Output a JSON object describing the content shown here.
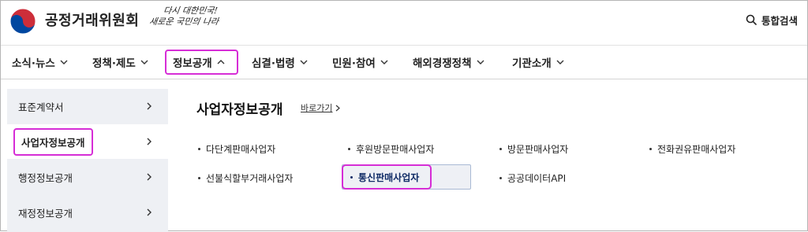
{
  "header": {
    "org_name": "공정거래위원회",
    "slogan_line1": "다시 대한민국!",
    "slogan_line2": "새로운 국민의 나라",
    "search_label": "통합검색",
    "logo_icon": "taegeuk-logo-icon"
  },
  "nav": {
    "items": [
      {
        "label": "소식·뉴스"
      },
      {
        "label": "정책·제도"
      },
      {
        "label": "정보공개",
        "active": true
      },
      {
        "label": "심결·법령"
      },
      {
        "label": "민원·참여"
      },
      {
        "label": "해외경쟁정책"
      },
      {
        "label": "기관소개"
      }
    ]
  },
  "sidebar": {
    "items": [
      {
        "label": "표준계약서"
      },
      {
        "label": "사업자정보공개",
        "active": true
      },
      {
        "label": "행정정보공개"
      },
      {
        "label": "재정정보공개"
      }
    ]
  },
  "main": {
    "title": "사업자정보공개",
    "goto_label": "바로가기",
    "links": [
      {
        "label": "다단계판매사업자"
      },
      {
        "label": "후원방문판매사업자"
      },
      {
        "label": "방문판매사업자"
      },
      {
        "label": "전화권유판매사업자"
      },
      {
        "label": "선불식할부거래사업자"
      },
      {
        "label": "통신판매사업자",
        "highlighted": true
      },
      {
        "label": "공공데이터API"
      }
    ]
  },
  "colors": {
    "highlight": "#d62dd6",
    "sidebar_bg": "#eef0f4",
    "logo_red": "#cd2e3a",
    "logo_blue": "#0047a0"
  }
}
